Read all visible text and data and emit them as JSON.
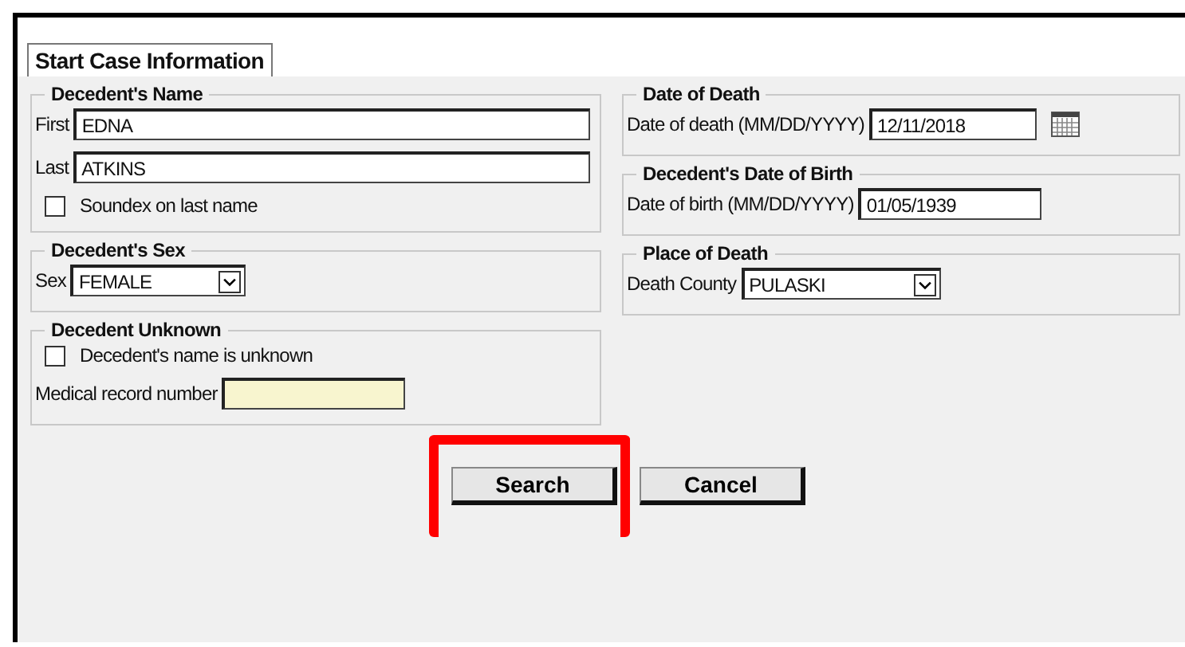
{
  "tab": {
    "label": "Start Case Information",
    "selected": true
  },
  "left_groups": [
    {
      "title": "Decedent's Name",
      "rows": [
        {
          "kind": "wide",
          "label": "First",
          "value": "EDNA",
          "highlighted": false
        },
        {
          "kind": "wide",
          "label": "Last",
          "value": "ATKINS",
          "highlighted": false
        },
        {
          "kind": "checkbox",
          "label": "Soundex on last name",
          "checked": false
        }
      ]
    },
    {
      "title": "Decedent's Sex",
      "rows": [
        {
          "kind": "select",
          "label": "Sex",
          "value": "FEMALE"
        }
      ]
    },
    {
      "title": "Decedent Unknown",
      "rows": [
        {
          "kind": "checkbox",
          "label": "Decedent's name is unknown",
          "checked": false
        },
        {
          "kind": "text",
          "label": "Medical record number",
          "value": "",
          "highlighted": true
        }
      ]
    }
  ],
  "right_groups": [
    {
      "title": "Date of Death",
      "rows": [
        {
          "kind": "date",
          "label": "Date of death (MM/DD/YYYY)",
          "value": "12/11/2018"
        }
      ]
    },
    {
      "title": "Decedent's Date of Birth",
      "rows": [
        {
          "kind": "text",
          "label": "Date of birth (MM/DD/YYYY)",
          "value": "01/05/1939",
          "highlighted": false
        }
      ]
    },
    {
      "title": "Place of Death",
      "rows": [
        {
          "kind": "select",
          "label": "Death County",
          "value": "PULASKI"
        }
      ]
    }
  ],
  "buttons": [
    {
      "label": "Search",
      "highlighted": true
    },
    {
      "label": "Cancel",
      "highlighted": false
    }
  ]
}
